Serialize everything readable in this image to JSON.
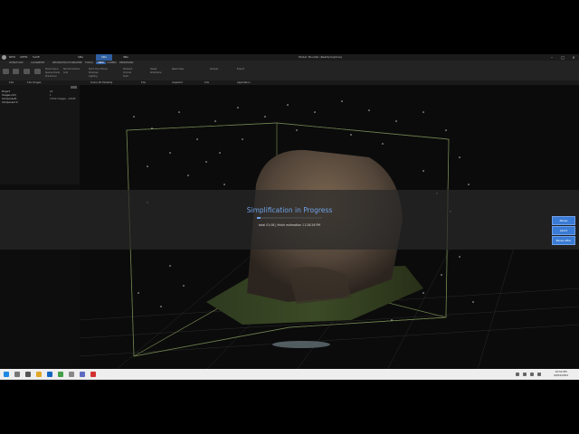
{
  "window": {
    "title": "Model: Boulder (RealityCapture)",
    "minimize_icon": "minimize-icon",
    "maximize_icon": "maximize-icon",
    "close_icon": "close-icon"
  },
  "quick_access": [
    "NEW",
    "OPEN",
    "SAVE"
  ],
  "doc_tabs": [
    {
      "label": "1Ds",
      "active": false
    },
    {
      "label": "1Ds",
      "active": true
    },
    {
      "label": "3Ds",
      "active": false
    }
  ],
  "ribbon": {
    "tabs": [
      "WORKFLOW",
      "ALIGNMENT",
      "RECONSTRUCTION",
      "SCENE",
      "TOOLS",
      "HELP",
      "VIEW",
      "CAMERA",
      "RENDERING"
    ],
    "active_tab": "VIEW",
    "tools": [
      "Mesh",
      "Alignment",
      "Reconstruction",
      "Camera",
      "Show Scene",
      "Sparse Points",
      "Pointcloud",
      "Normal Vectors",
      "Grid",
      "Point Cloud Mode",
      "Shadows",
      "Lighting",
      "Textured",
      "Colored",
      "Solid",
      "Sweet",
      "Wireframe",
      "Reset View",
      "Sample",
      "Export"
    ]
  },
  "panels": {
    "left_tab": "1Ds",
    "center_tab": "1Ds Images",
    "right_tabs": [
      "Scene 3D Modality",
      "1Ds",
      "Inspector",
      "1Ds",
      "Application"
    ]
  },
  "left_panel": {
    "tree": [
      "Project",
      "Images (22)",
      "Components",
      "Component 0"
    ],
    "values": [
      "",
      "22",
      "1",
      "17/22 images - 12345"
    ]
  },
  "progress": {
    "title": "Simplification in Progress",
    "fraction": 0.06,
    "status": "total 01:08 | finish estimation 11:28:26 PM"
  },
  "side_buttons": [
    "Pause",
    "Abort",
    "Pause after"
  ],
  "taskbar": {
    "date_time": "10:52 PM\n20/04/2022",
    "icons": [
      "windows-start-icon",
      "search-icon",
      "task-view-icon",
      "file-explorer-icon",
      "edge-icon",
      "chrome-icon",
      "settings-icon",
      "photos-icon",
      "store-icon",
      "realitycapture-icon",
      "media-icon",
      "app-icon"
    ]
  },
  "colors": {
    "accent": "#3a7bd5",
    "progress": "#6fa3e8",
    "taskbar": "#eeeeee"
  }
}
